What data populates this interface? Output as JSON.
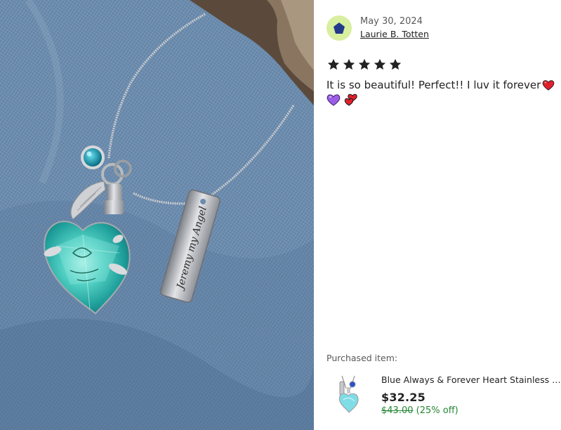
{
  "review": {
    "date": "May 30, 2024",
    "reviewer_name": "Laurie B. Totten",
    "rating": 5,
    "rating_max": 5,
    "text": "It is so beautiful! Perfect!! I luv it forever",
    "avatar_icon": "pentagon-icon",
    "emoji_icons": [
      "red-heart-emoji",
      "purple-heart-emoji",
      "two-hearts-emoji"
    ]
  },
  "purchased": {
    "label": "Purchased item:",
    "product_title": "Blue Always & Forever Heart Stainless Steel Cremation Urn Necklace",
    "price": "$32.25",
    "original_price": "$43.00",
    "discount": "(25% off)"
  },
  "photo": {
    "tag_engraving": "Jeremy my Angel"
  },
  "colors": {
    "avatar_bg": "#d8ef9f",
    "avatar_shape": "#233a8c",
    "sale_green": "#258635",
    "star": "#222222"
  }
}
